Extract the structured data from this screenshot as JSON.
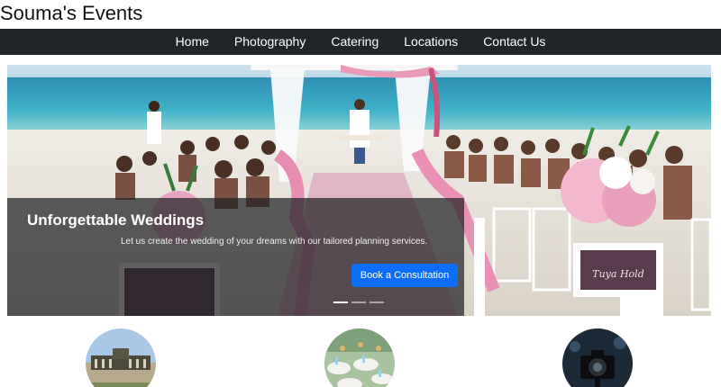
{
  "site": {
    "title": "Souma's Events"
  },
  "nav": {
    "items": [
      {
        "label": "Home"
      },
      {
        "label": "Photography"
      },
      {
        "label": "Catering"
      },
      {
        "label": "Locations"
      },
      {
        "label": "Contact Us"
      }
    ]
  },
  "hero": {
    "title": "Unforgettable Weddings",
    "text": "Let us create the wedding of your dreams with our tailored planning services.",
    "cta_label": "Book a Consultation",
    "sign_text": "Tuya Hold",
    "slide_count": 3,
    "active_slide": 1,
    "image_description": "beach wedding ceremony with white chairs and pink flowers"
  },
  "services": [
    {
      "name": "location-image",
      "icon": "palace-photo"
    },
    {
      "name": "catering-image",
      "icon": "catering-photo"
    },
    {
      "name": "photography-image",
      "icon": "camera-photo"
    }
  ],
  "colors": {
    "navbar": "#212529",
    "primary_button": "#0d6efd",
    "caption_overlay": "rgba(35,35,38,0.72)"
  }
}
